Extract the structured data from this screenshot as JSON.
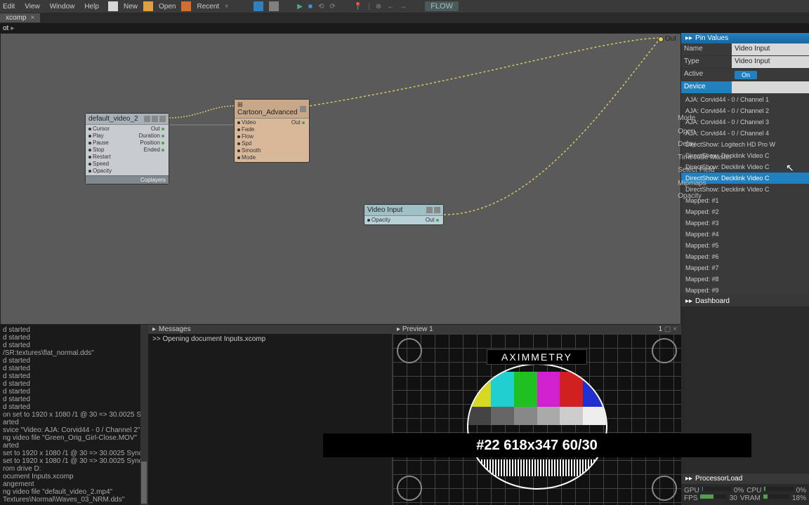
{
  "menu": {
    "edit": "Edit",
    "view": "View",
    "window": "Window",
    "help": "Help"
  },
  "toolbar": {
    "new": "New",
    "open": "Open",
    "recent": "Recent",
    "flow": "FLOW"
  },
  "tab": {
    "name": "xcomp"
  },
  "sec": {
    "root": "ot"
  },
  "canvas": {
    "out": "Out",
    "node1": {
      "title": "default_video_2",
      "ports_left": [
        "Cursor",
        "Play",
        "Pause",
        "Stop",
        "Restart",
        "Speed",
        "Opacity"
      ],
      "ports_right": [
        "Out",
        "Duration",
        "Position",
        "Ended"
      ],
      "footer": "Coplayers"
    },
    "node2": {
      "title": "Cartoon_Advanced",
      "ports_left": [
        "Video",
        "Fade",
        "Flow",
        "Spd",
        "Smooth",
        "Mode"
      ],
      "ports_right": [
        "Out"
      ]
    },
    "node3": {
      "title": "Video Input",
      "ports_left": [
        "Opacity"
      ],
      "ports_right": [
        "Out"
      ]
    }
  },
  "log": [
    "d started",
    "d started",
    "d started",
    "/SR:textures\\flat_normal.dds\"",
    "d started",
    "d started",
    "d started",
    "d started",
    "d started",
    "d started",
    "d started",
    "on set to 1920 x 1080 /1 @ 30 => 30.0025 Sync",
    "arted",
    "svice \"Video: AJA: Corvid44 - 0 / Channel 2\"",
    "ng video file \"Green_Orig_Girl-Close.MOV\"",
    "arted",
    "set to 1920 x 1080 /1 @ 30 => 30.0025 Sync",
    "set to 1920 x 1080 /1 @ 30 => 30.0025 Sync",
    "rom drive D:",
    "ocument Inputs.xcomp",
    "angement",
    "ng video file \"default_video_2.mp4\"",
    "Textures\\Normal\\Waves_03_NRM.dds\""
  ],
  "messages": {
    "title": "Messages",
    "line": ">> Opening document Inputs.xcomp"
  },
  "preview": {
    "title": "Preview 1",
    "num": "1",
    "brand": "AXIMMETRY",
    "id": "#22 618x347 60/30"
  },
  "pin": {
    "header": "Pin Values",
    "rows": {
      "name_l": "Name",
      "name_v": "Video Input",
      "type_l": "Type",
      "type_v": "Video Input",
      "active_l": "Active",
      "active_v": "On",
      "device_l": "Device",
      "mode_l": "Mode",
      "open_l": "Open",
      "delay_l": "Delay",
      "tc_l": "Timecode Master",
      "sel_l": "Select Field",
      "mip_l": "Mipmaps",
      "op_l": "Opacity"
    },
    "dropdown": [
      "AJA: Corvid44 - 0 / Channel 1",
      "AJA: Corvid44 - 0 / Channel 2",
      "AJA: Corvid44 - 0 / Channel 3",
      "AJA: Corvid44 - 0 / Channel 4",
      "DirectShow: Logitech HD Pro W",
      "DirectShow: Decklink Video C",
      "DirectShow: Decklink Video C",
      "DirectShow: Decklink Video C",
      "DirectShow: Decklink Video C",
      "Mapped: #1",
      "Mapped: #2",
      "Mapped: #3",
      "Mapped: #4",
      "Mapped: #5",
      "Mapped: #6",
      "Mapped: #7",
      "Mapped: #8",
      "Mapped: #9"
    ],
    "dd_selected_index": 7
  },
  "dashboard": {
    "header": "Dashboard"
  },
  "proc": {
    "header": "ProcessorLoad",
    "gpu_l": "GPU",
    "gpu_v": "0%",
    "cpu_l": "CPU",
    "cpu_v": "0%",
    "fps_l": "FPS",
    "fps_v": "30",
    "vram_l": "VRAM",
    "vram_v": "18%"
  }
}
